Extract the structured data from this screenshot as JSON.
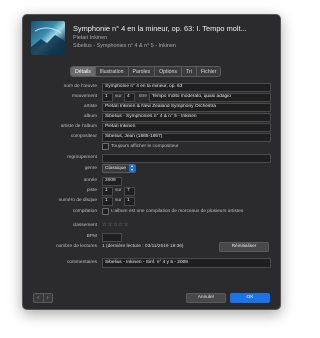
{
  "header": {
    "title": "Symphonie n° 4 en la mineur, op. 63: I. Tempo molt...",
    "artist": "Pietari Inkinen",
    "album": "Sibelius - Symphonies n° 4 & n° 5 - Inkinen"
  },
  "tabs": [
    "Détails",
    "Illustration",
    "Paroles",
    "Options",
    "Tri",
    "Fichier"
  ],
  "form": {
    "nom_label": "nom de l’œuvre",
    "nom_value": "Symphonie n° 4 en la mineur, op. 63",
    "mouvement_label": "mouvement",
    "mouvement_num": "1",
    "mouvement_sur": "sur",
    "mouvement_total": "4",
    "titre_label": "titre",
    "titre_value": "Tempo molto moderato, quasi adagio",
    "artiste_label": "artiste",
    "artiste_value": "Pietari Inkinen & New Zealand Symphony Orchestra",
    "album_label": "album",
    "album_value": "Sibelius - Symphonies n° 4 & n° 5 - Inkinen",
    "album_artist_label": "artiste de l’album",
    "album_artist_value": "Pietari Inkinen",
    "compositeur_label": "compositeur",
    "compositeur_value": "Sibelius, Jean (1865-1957)",
    "toujours_label": "Toujours afficher le compositeur",
    "regroupement_label": "regroupement",
    "regroupement_value": "",
    "genre_label": "genre",
    "genre_value": "Classique",
    "annee_label": "année",
    "annee_value": "2009",
    "piste_label": "piste",
    "piste_num": "1",
    "piste_sur": "sur",
    "piste_total": "7",
    "disque_label": "numéro de disque",
    "disque_num": "1",
    "disque_sur": "sur",
    "disque_total": "1",
    "compilation_label": "compilation",
    "compilation_text": "L’album est une compilation de morceaux de plusieurs artistes",
    "classement_label": "classement",
    "classement_stars": "☆☆☆☆☆",
    "bpm_label": "BPM",
    "bpm_value": "",
    "lectures_label": "nombre de lectures",
    "lectures_value": "1 (dernière lecture : 03/11/2019 19:36)",
    "reinit_label": "Réinitialiser",
    "commentaires_label": "commentaires",
    "commentaires_value": "Sibelius - Inkinen - Sinf. n° 4 y 5 - 2009"
  },
  "footer": {
    "prev_icon": "‹",
    "next_icon": "›",
    "cancel_label": "Annuler",
    "ok_label": "OK"
  },
  "colors": {
    "accent": "#1a73e8",
    "window_bg": "#2b2b2d"
  }
}
